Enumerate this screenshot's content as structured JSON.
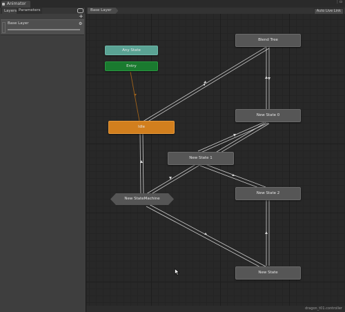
{
  "window": {
    "tab_title": "Animator"
  },
  "sidebar": {
    "tabs": [
      "Layers",
      "Parameters"
    ],
    "add_label": "+",
    "layer": {
      "name": "Base Layer",
      "gear": "⚙"
    }
  },
  "toolbar": {
    "breadcrumb": "Base Layer",
    "auto_live_link": "Auto Live Link"
  },
  "status": {
    "controller": "dragon_t01.controller"
  },
  "states": {
    "any_state": "Any State",
    "entry": "Entry",
    "idle": "Idle",
    "blend_tree": "Blend Tree",
    "new_state_0": "New State 0",
    "new_state_1": "New State 1",
    "new_state_2": "New State 2",
    "new_state": "New State",
    "state_machine": "New StateMachine"
  },
  "colors": {
    "default_state": "#d27f1e",
    "entry": "#1a7a2f",
    "any_state": "#5aa394",
    "state": "#565656"
  },
  "icons": {
    "cursor": "cursor-icon",
    "eye": "eye-icon",
    "gear": "gear-icon"
  }
}
